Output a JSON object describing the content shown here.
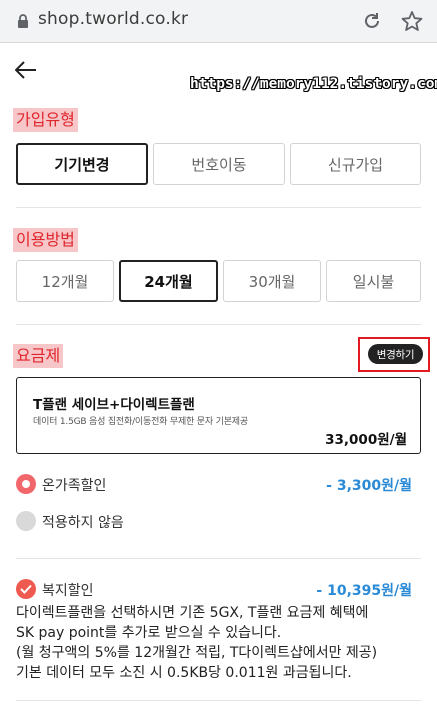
{
  "browser": {
    "url": "shop.tworld.co.kr",
    "lock_icon": "lock-icon",
    "reload_icon": "reload-icon",
    "bookmark_icon": "star-outline-icon"
  },
  "watermark": "https://memory112.tistory.com",
  "join_type": {
    "label": "가입유형",
    "options": [
      "기기변경",
      "번호이동",
      "신규가입"
    ],
    "selected": "기기변경"
  },
  "usage_period": {
    "label": "이용방법",
    "options": [
      "12개월",
      "24개월",
      "30개월",
      "일시불"
    ],
    "selected": "24개월"
  },
  "rate_plan": {
    "label": "요금제",
    "change_button": "변경하기",
    "plan_name": "T플랜 세이브+다이렉트플랜",
    "plan_desc": "데이터 1.5GB  음성 집전화/이동전화 무제한  문자 기본제공",
    "plan_price": "33,000원/월"
  },
  "family_discount": {
    "options": [
      {
        "label": "온가족할인",
        "amount": "- 3,300원/월",
        "selected": true
      },
      {
        "label": "적용하지 않음",
        "amount": "",
        "selected": false
      }
    ]
  },
  "welfare": {
    "label": "복지할인",
    "amount": "- 10,395원/월",
    "checked": true,
    "lines": [
      "다이렉트플랜을 선택하시면 기존 5GX, T플랜 요금제 혜택에",
      "SK pay point를 추가로 받으실 수 있습니다.",
      "(월 청구액의 5%를 12개월간 적립, T다이렉트샵에서만 제공)",
      "기본 데이터 모두 소진 시 0.5KB당 0.011원 과금됩니다."
    ]
  },
  "colors": {
    "accent_red": "#e0262d",
    "label_bg": "#f6c6c8",
    "discount_blue": "#2a8ad6",
    "radio_on": "#f2676b"
  }
}
